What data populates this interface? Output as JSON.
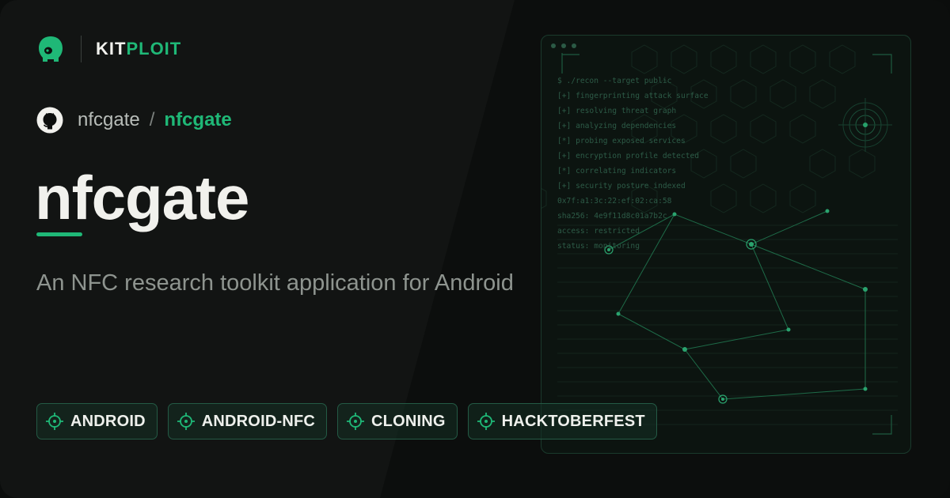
{
  "brand": {
    "name_part1": "KIT",
    "name_part2": "PLOIT",
    "logo_icon": "kitploit-helmet-icon",
    "accent": "#1fb877"
  },
  "repo": {
    "icon": "github-icon",
    "owner": "nfcgate",
    "separator": "/",
    "name": "nfcgate"
  },
  "title": "nfcgate",
  "description": "An NFC research toolkit application for Android",
  "tags": [
    {
      "label": "ANDROID",
      "icon": "crosshair-icon"
    },
    {
      "label": "ANDROID-NFC",
      "icon": "crosshair-icon"
    },
    {
      "label": "CLONING",
      "icon": "crosshair-icon"
    },
    {
      "label": "HACKTOBERFEST",
      "icon": "crosshair-icon"
    }
  ],
  "terminal": {
    "lines": [
      "$ ./recon --target public",
      "[+] fingerprinting attack surface",
      "[+] resolving threat graph",
      "[+] analyzing dependencies",
      "[*] probing exposed services",
      "[+] encryption profile detected",
      "[*] correlating indicators",
      "[+] security posture indexed",
      "0x7f:a1:3c:22:ef:02:ca:58",
      "sha256: 4e9f11d8c01a7b2c",
      "access: restricted",
      "status: monitoring"
    ]
  },
  "colors": {
    "background": "#0c0e0d",
    "accent": "#1fb877",
    "tag_border": "#245a45",
    "text": "#f1f1ed",
    "muted": "#8e948f"
  }
}
